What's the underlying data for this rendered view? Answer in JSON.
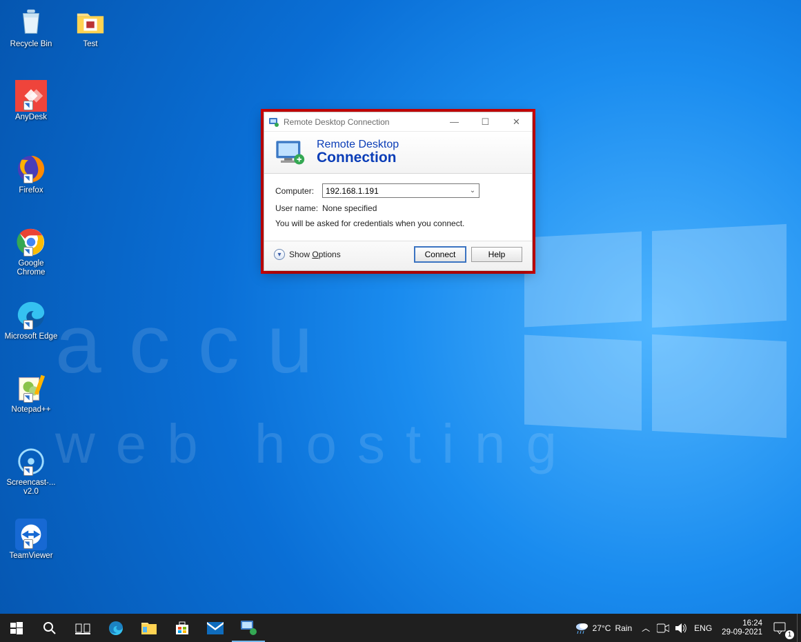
{
  "desktop_icons": [
    {
      "label": "Recycle Bin",
      "name": "recycle-bin"
    },
    {
      "label": "Test",
      "name": "folder-test"
    },
    {
      "label": "AnyDesk",
      "name": "anydesk"
    },
    {
      "label": "Firefox",
      "name": "firefox"
    },
    {
      "label": "Google Chrome",
      "name": "chrome"
    },
    {
      "label": "Microsoft Edge",
      "name": "edge"
    },
    {
      "label": "Notepad++",
      "name": "notepadpp"
    },
    {
      "label": "Screencast-... v2.0",
      "name": "screencast"
    },
    {
      "label": "TeamViewer",
      "name": "teamviewer"
    }
  ],
  "watermark": {
    "line1": "accu",
    "line2": "web hosting"
  },
  "rdc": {
    "title": "Remote Desktop Connection",
    "banner_l1": "Remote Desktop",
    "banner_l2": "Connection",
    "computer_label": "Computer:",
    "computer_value": "192.168.1.191",
    "username_label": "User name:",
    "username_value": "None specified",
    "hint": "You will be asked for credentials when you connect.",
    "show_options": "Show Options",
    "connect": "Connect",
    "help": "Help",
    "minimize": "—",
    "maximize": "☐",
    "close": "✕"
  },
  "taskbar": {
    "weather_temp": "27°C",
    "weather_desc": "Rain",
    "lang": "ENG",
    "time": "16:24",
    "date": "29-09-2021",
    "notif_count": "1"
  },
  "colors": {
    "highlight": "#d40000",
    "accent": "#0a3db7",
    "taskbar": "#1f1f1f"
  }
}
